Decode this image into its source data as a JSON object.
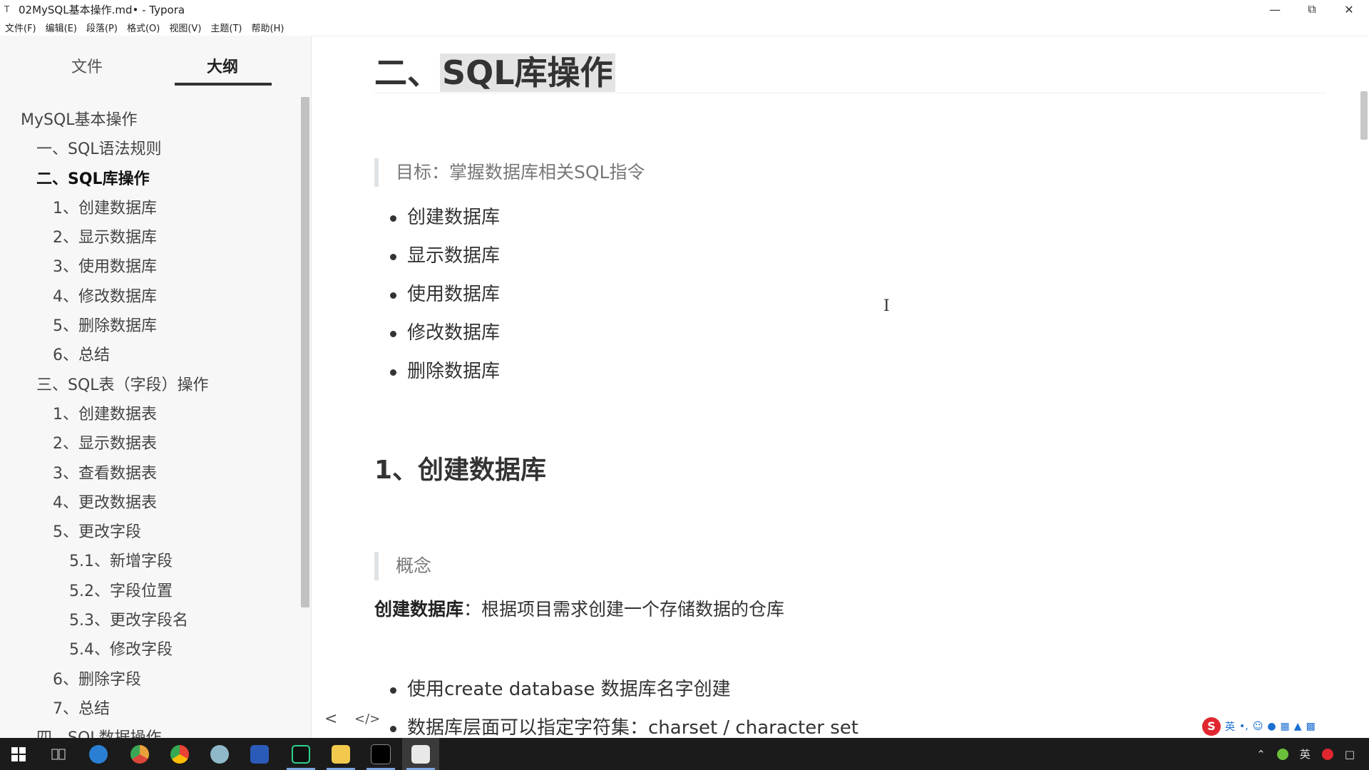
{
  "window": {
    "title": "02MySQL基本操作.md• - Typora"
  },
  "menu": [
    "文件(F)",
    "编辑(E)",
    "段落(P)",
    "格式(O)",
    "视图(V)",
    "主题(T)",
    "帮助(H)"
  ],
  "sidebar": {
    "tabs": {
      "files": "文件",
      "outline": "大纲"
    },
    "items": [
      {
        "label": "MySQL基本操作"
      },
      {
        "label": "一、SQL语法规则"
      },
      {
        "label": "二、SQL库操作"
      },
      {
        "label": "1、创建数据库"
      },
      {
        "label": "2、显示数据库"
      },
      {
        "label": "3、使用数据库"
      },
      {
        "label": "4、修改数据库"
      },
      {
        "label": "5、删除数据库"
      },
      {
        "label": "6、总结"
      },
      {
        "label": "三、SQL表（字段）操作"
      },
      {
        "label": "1、创建数据表"
      },
      {
        "label": "2、显示数据表"
      },
      {
        "label": "3、查看数据表"
      },
      {
        "label": "4、更改数据表"
      },
      {
        "label": "5、更改字段"
      },
      {
        "label": "5.1、新增字段"
      },
      {
        "label": "5.2、字段位置"
      },
      {
        "label": "5.3、更改字段名"
      },
      {
        "label": "5.4、修改字段"
      },
      {
        "label": "6、删除字段"
      },
      {
        "label": "7、总结"
      },
      {
        "label": "四、SQL数据操作"
      }
    ],
    "footer": {
      "back": "<",
      "source": "</>"
    }
  },
  "editor": {
    "heading": {
      "prefix": "二、",
      "highlight": "SQL库操作"
    },
    "goal_quote": "目标：掌握数据库相关SQL指令",
    "goal_list": [
      "创建数据库",
      "显示数据库",
      "使用数据库",
      "修改数据库",
      "删除数据库"
    ],
    "section_heading": "1、创建数据库",
    "concept_quote": "概念",
    "definition": {
      "term": "创建数据库",
      "text": "：根据项目需求创建一个存储数据的仓库"
    },
    "detail_list": [
      "使用create database 数据库名字创建",
      "数据库层面可以指定字符集：charset / character set"
    ],
    "text_cursor": "I"
  },
  "ime": {
    "logo": "S",
    "lang": "英",
    "punct": "•,"
  },
  "taskbar": {
    "tray_lang": "英",
    "apps": [
      "start",
      "task-view",
      "ie",
      "chrome-canary",
      "chrome",
      "paw",
      "powershell",
      "pycharm",
      "explorer",
      "terminal",
      "typora"
    ]
  },
  "colors": {
    "taskbar_bg": "#1b1b1b",
    "sidebar_bg": "#f7f7f7",
    "heading_highlight": "#e4e4e4"
  }
}
